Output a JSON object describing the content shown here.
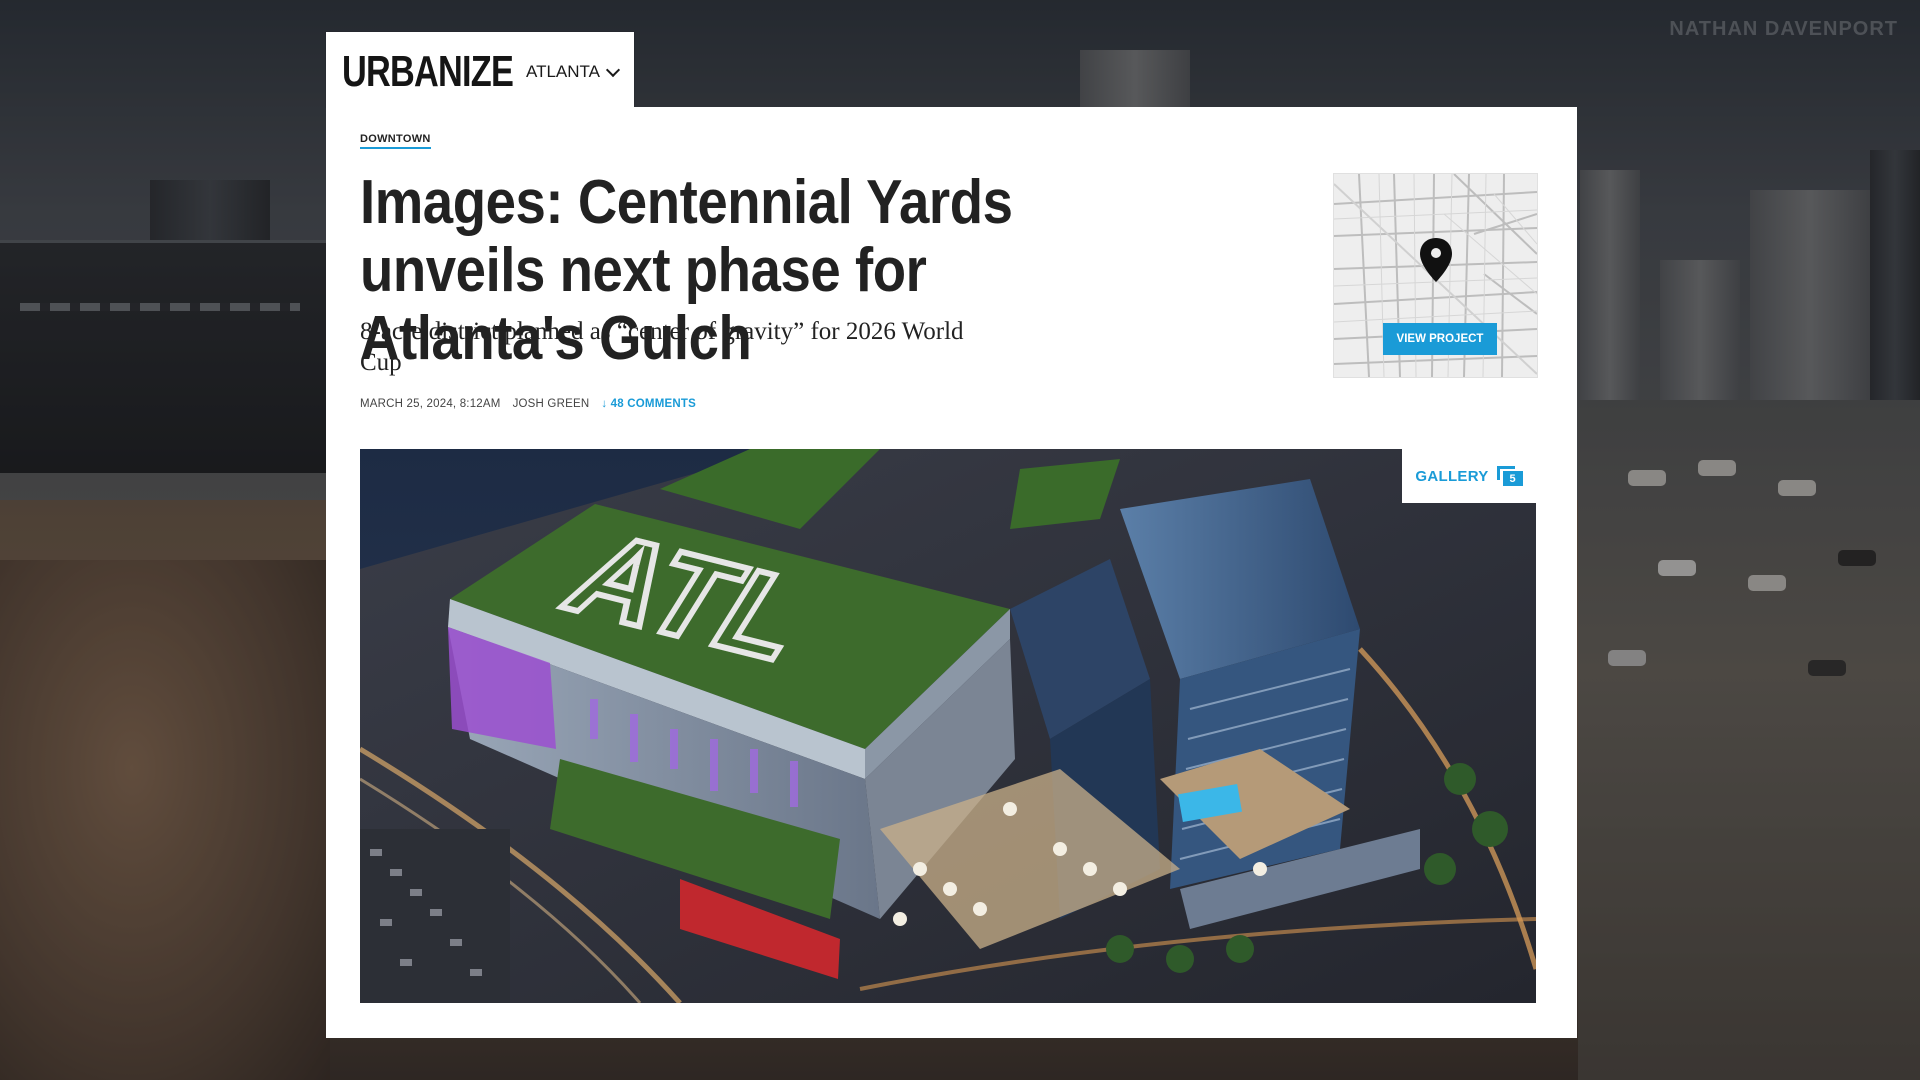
{
  "watermark": "NATHAN DAVENPORT",
  "site": {
    "logo": "URBANIZE",
    "city": "ATLANTA"
  },
  "article": {
    "category": "DOWNTOWN",
    "title": "Images: Centennial Yards unveils next phase for Atlanta's Gulch",
    "subtitle": "8-acre district planned as “center of gravity” for 2026 World Cup",
    "date": "MARCH 25, 2024, 8:12AM",
    "author": "JOSH GREEN",
    "comments": "↓ 48 COMMENTS",
    "view_project_label": "VIEW PROJECT",
    "gallery_label": "GALLERY",
    "gallery_count": "5",
    "hero_roof_text": "ATL"
  },
  "colors": {
    "accent": "#1a9bd7",
    "text": "#222222",
    "card": "#ffffff"
  },
  "icons": {
    "map_pin": "map-pin-icon",
    "chevron": "chevron-down-icon",
    "gallery": "gallery-icon"
  }
}
